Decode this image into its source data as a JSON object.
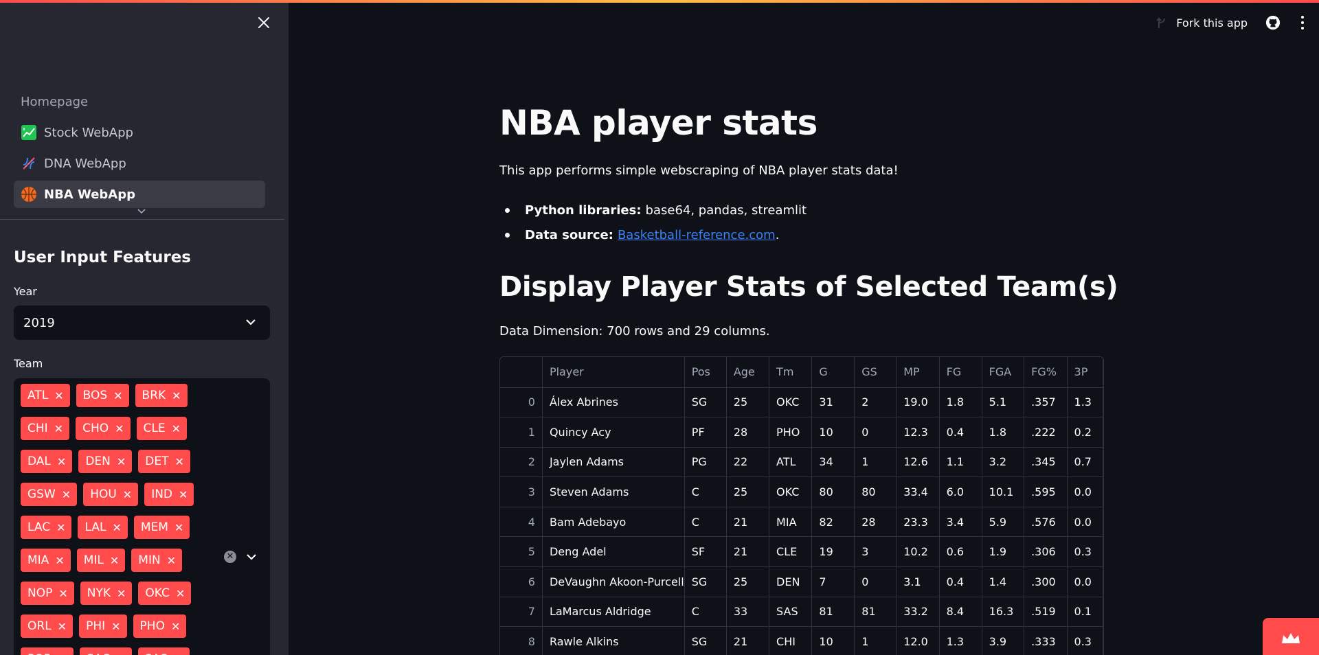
{
  "sidebar": {
    "nav": [
      {
        "label": "Homepage",
        "icon": "none"
      },
      {
        "label": "Stock WebApp",
        "icon": "chart-icon"
      },
      {
        "label": "DNA WebApp",
        "icon": "dna-icon"
      },
      {
        "label": "NBA WebApp",
        "icon": "basketball-icon"
      }
    ],
    "title": "User Input Features",
    "year_label": "Year",
    "year_value": "2019",
    "team_label": "Team",
    "teams": [
      "ATL",
      "BOS",
      "BRK",
      "CHI",
      "CHO",
      "CLE",
      "DAL",
      "DEN",
      "DET",
      "GSW",
      "HOU",
      "IND",
      "LAC",
      "LAL",
      "MEM",
      "MIA",
      "MIL",
      "MIN",
      "NOP",
      "NYK",
      "OKC",
      "ORL",
      "PHI",
      "PHO",
      "POR",
      "SAC",
      "SAS"
    ],
    "tag_remove_glyph": "✕"
  },
  "header": {
    "fork_label": "Fork this app"
  },
  "main": {
    "title": "NBA player stats",
    "intro": "This app performs simple webscraping of NBA player stats data!",
    "libs_label": "Python libraries:",
    "libs_value": "base64, pandas, streamlit",
    "source_label": "Data source:",
    "source_link": "Basketball-reference.com",
    "source_suffix": ".",
    "subtitle": "Display Player Stats of Selected Team(s)",
    "dimensions": "Data Dimension: 700 rows and 29 columns."
  },
  "table": {
    "columns": [
      "",
      "Player",
      "Pos",
      "Age",
      "Tm",
      "G",
      "GS",
      "MP",
      "FG",
      "FGA",
      "FG%",
      "3P"
    ],
    "rows": [
      [
        "0",
        "Álex Abrines",
        "SG",
        "25",
        "OKC",
        "31",
        "2",
        "19.0",
        "1.8",
        "5.1",
        ".357",
        "1.3"
      ],
      [
        "1",
        "Quincy Acy",
        "PF",
        "28",
        "PHO",
        "10",
        "0",
        "12.3",
        "0.4",
        "1.8",
        ".222",
        "0.2"
      ],
      [
        "2",
        "Jaylen Adams",
        "PG",
        "22",
        "ATL",
        "34",
        "1",
        "12.6",
        "1.1",
        "3.2",
        ".345",
        "0.7"
      ],
      [
        "3",
        "Steven Adams",
        "C",
        "25",
        "OKC",
        "80",
        "80",
        "33.4",
        "6.0",
        "10.1",
        ".595",
        "0.0"
      ],
      [
        "4",
        "Bam Adebayo",
        "C",
        "21",
        "MIA",
        "82",
        "28",
        "23.3",
        "3.4",
        "5.9",
        ".576",
        "0.0"
      ],
      [
        "5",
        "Deng Adel",
        "SF",
        "21",
        "CLE",
        "19",
        "3",
        "10.2",
        "0.6",
        "1.9",
        ".306",
        "0.3"
      ],
      [
        "6",
        "DeVaughn Akoon-Purcell",
        "SG",
        "25",
        "DEN",
        "7",
        "0",
        "3.1",
        "0.4",
        "1.4",
        ".300",
        "0.0"
      ],
      [
        "7",
        "LaMarcus Aldridge",
        "C",
        "33",
        "SAS",
        "81",
        "81",
        "33.2",
        "8.4",
        "16.3",
        ".519",
        "0.1"
      ],
      [
        "8",
        "Rawle Alkins",
        "SG",
        "21",
        "CHI",
        "10",
        "1",
        "12.0",
        "1.3",
        "3.9",
        ".333",
        "0.3"
      ]
    ]
  },
  "colors": {
    "accent": "#ff4b4b",
    "background": "#0e1117",
    "sidebar": "#262730",
    "link": "#3b82f6"
  }
}
